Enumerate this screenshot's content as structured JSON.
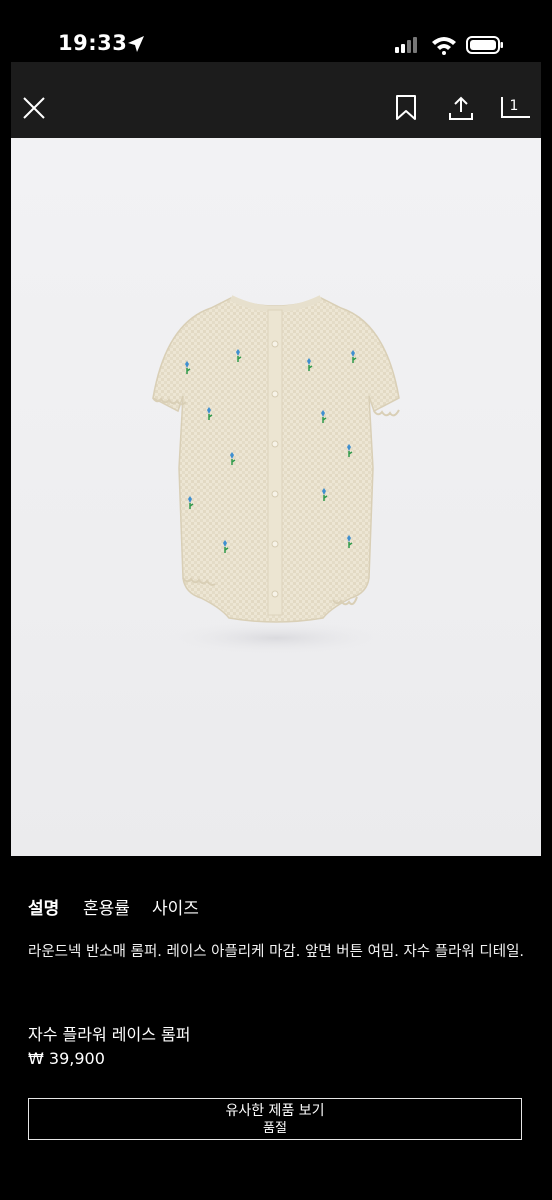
{
  "status_bar": {
    "time": "19:33"
  },
  "toolbar": {
    "gallery_count": "1"
  },
  "tabs": [
    "설명",
    "혼용률",
    "사이즈"
  ],
  "product": {
    "description": "라운드넥 반소매 롬퍼. 레이스 아플리케 마감. 앞면 버튼 여밈. 자수 플라워 디테일.",
    "name": "자수 플라워 레이스 롬퍼",
    "price": "₩ 39,900"
  },
  "actions": {
    "similar_label": "유사한 제품 보기",
    "soldout_label": "품절"
  },
  "colors": {
    "background": "#000000",
    "toolbar": "#1c1c1c",
    "text": "#ffffff",
    "embroidery_flower": "#3f8fd0",
    "embroidery_leaf": "#2f9a4a"
  }
}
